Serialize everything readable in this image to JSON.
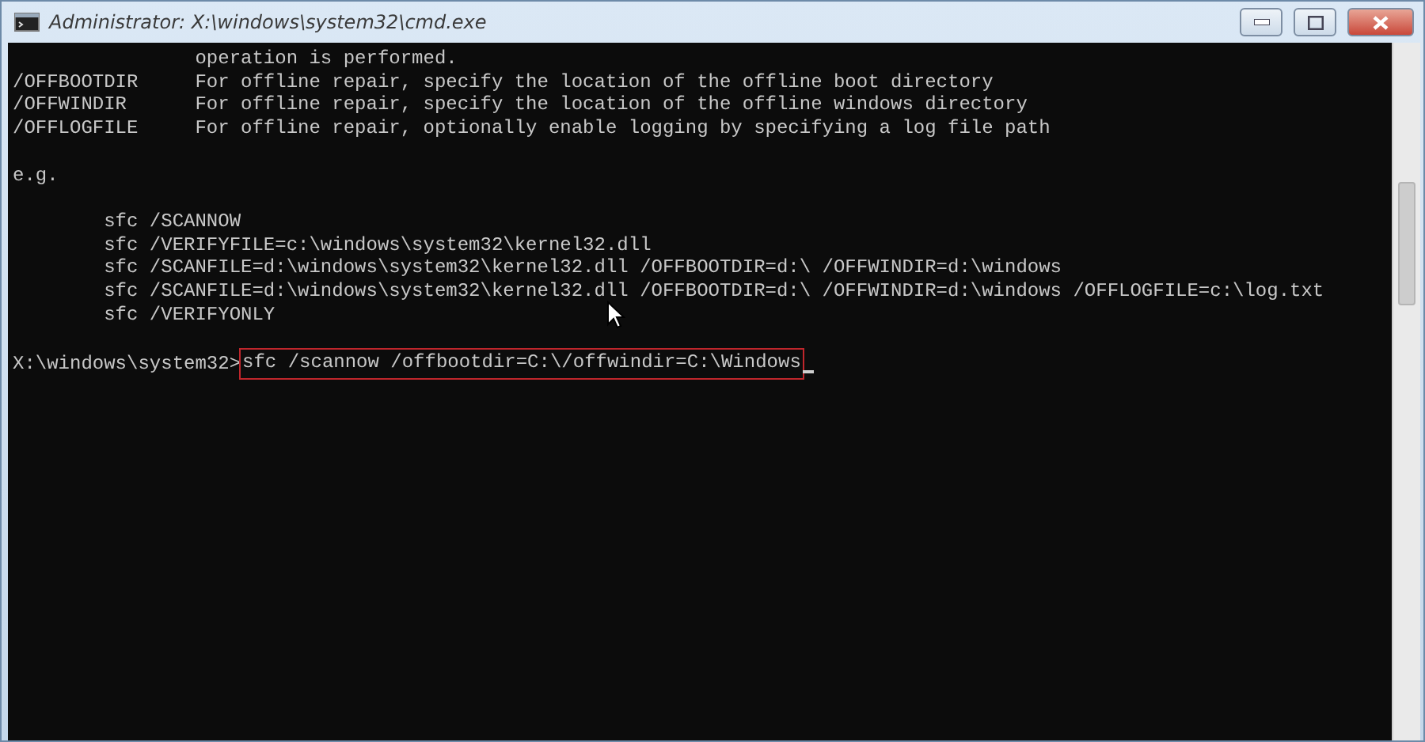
{
  "window": {
    "title": "Administrator: X:\\windows\\system32\\cmd.exe"
  },
  "blocks": [
    [
      "                operation is performed.",
      "/OFFBOOTDIR     For offline repair, specify the location of the offline boot directory",
      "/OFFWINDIR      For offline repair, specify the location of the offline windows directory",
      "/OFFLOGFILE     For offline repair, optionally enable logging by specifying a log file path"
    ],
    [
      "e.g."
    ],
    [
      "        sfc /SCANNOW",
      "        sfc /VERIFYFILE=c:\\windows\\system32\\kernel32.dll",
      "        sfc /SCANFILE=d:\\windows\\system32\\kernel32.dll /OFFBOOTDIR=d:\\ /OFFWINDIR=d:\\windows",
      "        sfc /SCANFILE=d:\\windows\\system32\\kernel32.dll /OFFBOOTDIR=d:\\ /OFFWINDIR=d:\\windows /OFFLOGFILE=c:\\log.txt",
      "        sfc /VERIFYONLY"
    ]
  ],
  "prompt": {
    "path": "X:\\windows\\system32>",
    "command": "sfc /scannow /offbootdir=C:\\/offwindir=C:\\Windows",
    "highlighted": true
  }
}
